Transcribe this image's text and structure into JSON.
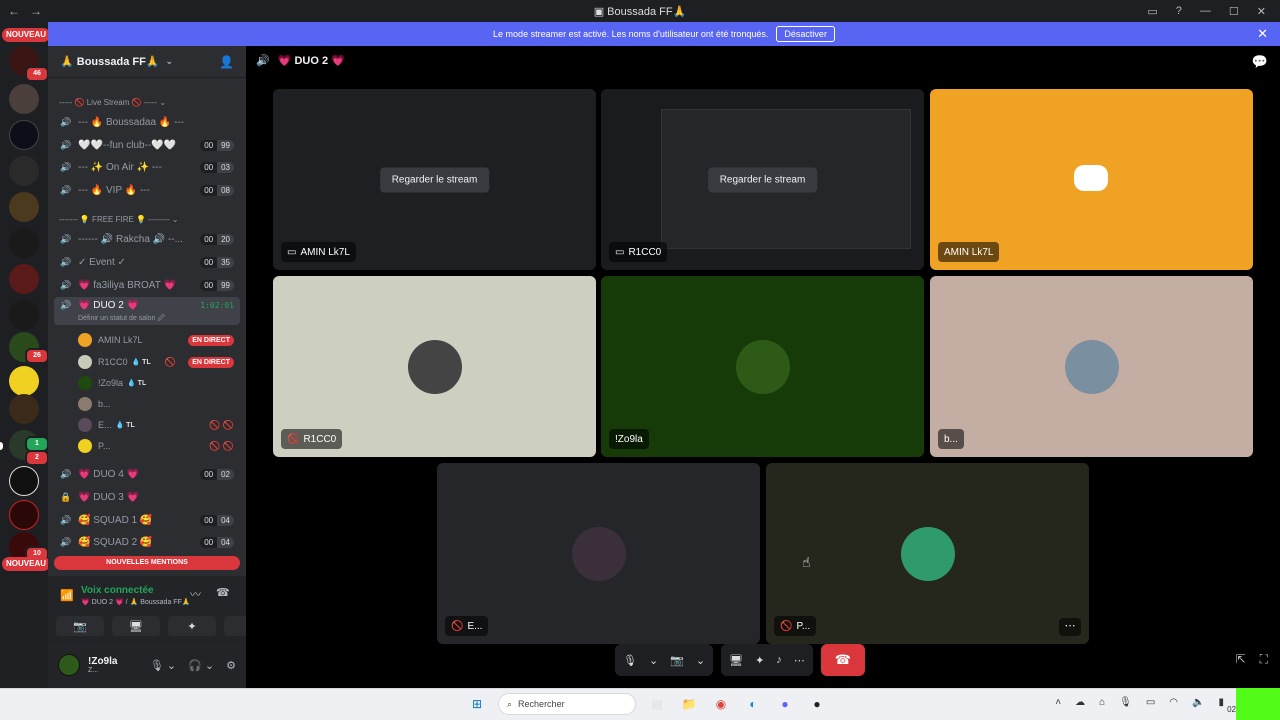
{
  "window": {
    "title": "Boussada FF🙏",
    "nav_back": "←",
    "nav_forward": "→"
  },
  "banner": {
    "text": "Le mode streamer est activé. Les noms d'utilisateur ont été tronqués.",
    "button": "Désactiver"
  },
  "rail": {
    "new_top": "NOUVEAU",
    "new_bottom": "NOUVEAU",
    "badges": [
      "46",
      "26",
      "1",
      "2",
      "10"
    ]
  },
  "server": {
    "name": "🙏 Boussada FF🙏"
  },
  "categories": {
    "live": "----- 🚫 Live Stream 🚫 ----- ⌄",
    "freefire": "------- 💡 FREE FIRE 💡 -------- ⌄"
  },
  "channels": [
    {
      "label": "--- 🔥 Boussadaa 🔥 ---",
      "a": "",
      "b": ""
    },
    {
      "label": "🤍🤍--fun club--🤍🤍",
      "a": "00",
      "b": "99"
    },
    {
      "label": "--- ✨ On Air ✨ ---",
      "a": "00",
      "b": "03"
    },
    {
      "label": "--- 🔥 VIP 🔥 ---",
      "a": "00",
      "b": "08"
    },
    {
      "label": "------ 🔊 Rakcha 🔊 --...",
      "a": "00",
      "b": "20"
    },
    {
      "label": "✓ Event ✓",
      "a": "00",
      "b": "35"
    },
    {
      "label": "💗 fa3iliya BROAT 💗",
      "a": "00",
      "b": "99"
    }
  ],
  "active_channel": {
    "label": "💗 DUO 2 💗",
    "timer": "1:02:01",
    "sub": "Définir un statut de salon 🖉"
  },
  "voice_users": [
    {
      "name": "AMIN Lk7L",
      "tag": "",
      "live": "EN DIRECT"
    },
    {
      "name": "R1CC0",
      "tag": "💧 TL",
      "live": "EN DIRECT"
    },
    {
      "name": "!Zo9la",
      "tag": "💧 TL",
      "live": ""
    },
    {
      "name": "b...",
      "tag": "",
      "live": ""
    },
    {
      "name": "E...",
      "tag": "💧 TL",
      "live": ""
    },
    {
      "name": "P...",
      "tag": "",
      "live": ""
    }
  ],
  "channels_after": [
    {
      "label": "💗 DUO 4 💗",
      "a": "00",
      "b": "02"
    },
    {
      "label": "💗 DUO 3 💗",
      "a": "",
      "b": ""
    },
    {
      "label": "🥰 SQUAD 1 🥰",
      "a": "00",
      "b": "04"
    },
    {
      "label": "🥰 SQUAD 2 🥰",
      "a": "00",
      "b": "04"
    }
  ],
  "mentions": "NOUVELLES MENTIONS",
  "voice_panel": {
    "status": "Voix connectée",
    "location": "💗 DUO 2 💗 / 🙏 Boussada FF🙏"
  },
  "user": {
    "name": "!Zo9la",
    "status": "Z..."
  },
  "stage": {
    "channel": "💗 DUO 2 💗"
  },
  "tiles": [
    {
      "name": "AMIN Lk7L",
      "watch": "Regarder le stream"
    },
    {
      "name": "R1CC0",
      "watch": "Regarder le stream"
    },
    {
      "name": "AMIN Lk7L",
      "watch": ""
    },
    {
      "name": "R1CC0",
      "watch": ""
    },
    {
      "name": "!Zo9la",
      "watch": ""
    },
    {
      "name": "b...",
      "watch": ""
    },
    {
      "name": "E...",
      "watch": ""
    },
    {
      "name": "P...",
      "watch": ""
    }
  ],
  "taskbar": {
    "search": "Rechercher",
    "time": "02"
  },
  "colors": {
    "blurple": "#5865f2",
    "red": "#da373c",
    "green": "#23a55a",
    "discord_orange": "#f0a224"
  }
}
